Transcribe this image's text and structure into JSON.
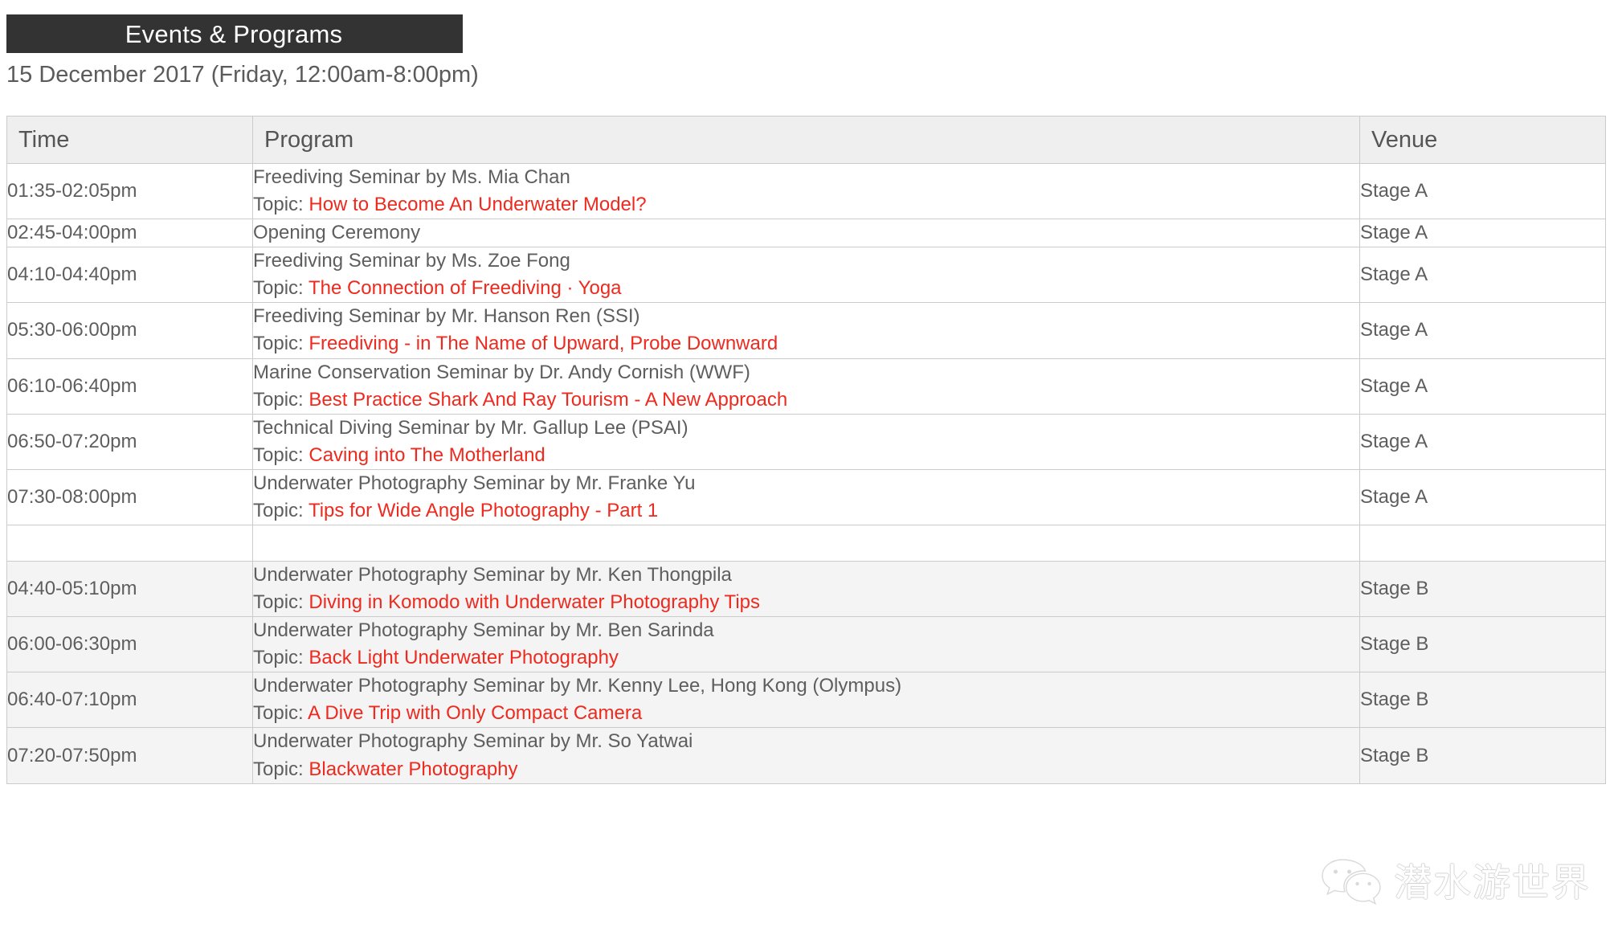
{
  "header": {
    "banner_title": "Events & Programs",
    "date_line": "15 December 2017 (Friday, 12:00am-8:00pm)",
    "banner_bg": "#333333",
    "accent_topic_color": "#ee2a1f"
  },
  "table": {
    "columns": {
      "time": "Time",
      "program": "Program",
      "venue": "Venue"
    },
    "topic_label": "Topic: ",
    "rows": [
      {
        "time": "01:35-02:05pm",
        "speaker": "Freediving Seminar by Ms. Mia Chan",
        "topic": "How to Become An Underwater Model?",
        "venue": "Stage A",
        "alt": false,
        "spacer": false
      },
      {
        "time": "02:45-04:00pm",
        "speaker": "Opening Ceremony",
        "topic": "",
        "venue": "Stage A",
        "alt": false,
        "spacer": false
      },
      {
        "time": "04:10-04:40pm",
        "speaker": "Freediving Seminar by Ms. Zoe Fong",
        "topic": "The Connection of Freediving · Yoga",
        "venue": "Stage A",
        "alt": false,
        "spacer": false
      },
      {
        "time": "05:30-06:00pm",
        "speaker": "Freediving Seminar by Mr. Hanson Ren (SSI)",
        "topic": "Freediving - in The Name of Upward, Probe Downward",
        "venue": "Stage A",
        "alt": false,
        "spacer": false
      },
      {
        "time": "06:10-06:40pm",
        "speaker": "Marine Conservation Seminar by Dr. Andy Cornish (WWF)",
        "topic": "Best Practice Shark And Ray Tourism - A New Approach",
        "venue": "Stage A",
        "alt": false,
        "spacer": false
      },
      {
        "time": "06:50-07:20pm",
        "speaker": "Technical Diving Seminar by Mr. Gallup Lee (PSAI)",
        "topic": "Caving into The Motherland",
        "venue": "Stage A",
        "alt": false,
        "spacer": false
      },
      {
        "time": "07:30-08:00pm",
        "speaker": "Underwater Photography Seminar by Mr. Franke Yu",
        "topic": "Tips for Wide Angle Photography - Part 1",
        "venue": "Stage A",
        "alt": false,
        "spacer": false
      },
      {
        "time": "",
        "speaker": "",
        "topic": "",
        "venue": "",
        "alt": false,
        "spacer": true
      },
      {
        "time": "04:40-05:10pm",
        "speaker": "Underwater Photography Seminar by Mr. Ken Thongpila",
        "topic": "Diving in Komodo with Underwater Photography Tips",
        "venue": "Stage B",
        "alt": true,
        "spacer": false
      },
      {
        "time": "06:00-06:30pm",
        "speaker": "Underwater Photography Seminar by Mr. Ben Sarinda",
        "topic": "Back Light Underwater Photography",
        "venue": "Stage B",
        "alt": true,
        "spacer": false
      },
      {
        "time": "06:40-07:10pm",
        "speaker": "Underwater Photography Seminar by Mr. Kenny Lee, Hong Kong (Olympus)",
        "topic": "A Dive Trip with Only Compact Camera",
        "venue": "Stage B",
        "alt": true,
        "spacer": false
      },
      {
        "time": "07:20-07:50pm",
        "speaker": "Underwater Photography Seminar by Mr. So Yatwai",
        "topic": "Blackwater Photography",
        "venue": "Stage B",
        "alt": true,
        "spacer": false
      }
    ]
  },
  "watermark": {
    "icon": "wechat-icon",
    "text": "潜水游世界"
  }
}
